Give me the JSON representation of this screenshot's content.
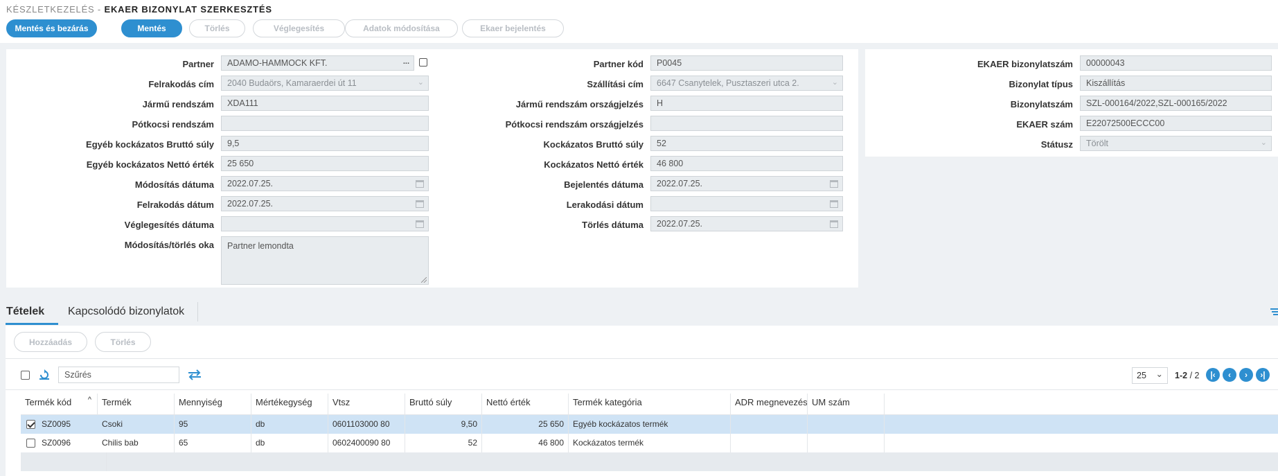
{
  "breadcrumb": {
    "parent": "KÉSZLETKEZELÉS -",
    "current": "EKAER BIZONYLAT SZERKESZTÉS"
  },
  "toolbar": {
    "save_close": "Mentés és bezárás",
    "save": "Mentés",
    "delete": "Törlés",
    "finalize": "Véglegesítés",
    "modify_data": "Adatok módosítása",
    "report": "Ekaer bejelentés"
  },
  "form_left": {
    "partner_label": "Partner",
    "partner_value": "ADAMO-HAMMOCK KFT.",
    "loading_addr_label": "Felrakodás cím",
    "loading_addr_value": "2040 Budaörs, Kamaraerdei út 11",
    "vehicle_plate_label": "Jármű rendszám",
    "vehicle_plate_value": "XDA111",
    "trailer_plate_label": "Pótkocsi rendszám",
    "trailer_plate_value": "",
    "other_gross_label": "Egyéb kockázatos Bruttó súly",
    "other_gross_value": "9,5",
    "other_net_label": "Egyéb kockázatos Nettó érték",
    "other_net_value": "25 650",
    "mod_date_label": "Módosítás dátuma",
    "mod_date_value": "2022.07.25.",
    "load_date_label": "Felrakodás dátum",
    "load_date_value": "2022.07.25.",
    "final_date_label": "Véglegesítés dátuma",
    "final_date_value": "",
    "reason_label": "Módosítás/törlés oka",
    "reason_value": "Partner lemondta"
  },
  "form_mid": {
    "partner_code_label": "Partner kód",
    "partner_code_value": "P0045",
    "delivery_addr_label": "Szállítási cím",
    "delivery_addr_value": "6647 Csanytelek, Pusztaszeri utca 2.",
    "vehicle_country_label": "Jármű rendszám országjelzés",
    "vehicle_country_value": "H",
    "trailer_country_label": "Pótkocsi rendszám országjelzés",
    "trailer_country_value": "",
    "risky_gross_label": "Kockázatos Bruttó súly",
    "risky_gross_value": "52",
    "risky_net_label": "Kockázatos Nettó érték",
    "risky_net_value": "46 800",
    "report_date_label": "Bejelentés dátuma",
    "report_date_value": "2022.07.25.",
    "unload_date_label": "Lerakodási dátum",
    "unload_date_value": "",
    "delete_date_label": "Törlés dátuma",
    "delete_date_value": "2022.07.25."
  },
  "form_right": {
    "doc_no_label": "EKAER bizonylatszám",
    "doc_no_value": "00000043",
    "doc_type_label": "Bizonylat típus",
    "doc_type_value": "Kiszállítás",
    "doc_nums_label": "Bizonylatszám",
    "doc_nums_value": "SZL-000164/2022,SZL-000165/2022",
    "ekaer_no_label": "EKAER szám",
    "ekaer_no_value": "E22072500ECCC00",
    "status_label": "Státusz",
    "status_value": "Törölt"
  },
  "tabs": {
    "items": "Tételek",
    "related": "Kapcsolódó bizonylatok"
  },
  "grid_toolbar": {
    "add": "Hozzáadás",
    "delete": "Törlés",
    "filter_placeholder": "Szűrés",
    "page_size": "25",
    "range": "1-2",
    "total": "/ 2"
  },
  "columns": [
    "Termék kód",
    "Termék",
    "Mennyiség",
    "Mértékegység",
    "Vtsz",
    "Bruttó súly",
    "Nettó érték",
    "Termék kategória",
    "ADR megnevezés",
    "UM szám"
  ],
  "rows": [
    {
      "code": "SZ0095",
      "product": "Csoki",
      "qty": "95",
      "unit": "db",
      "vtsz": "0601103000 80",
      "gross": "9,50",
      "net": "25 650",
      "category": "Egyéb kockázatos termék",
      "adr": "",
      "um": "",
      "checked": true
    },
    {
      "code": "SZ0096",
      "product": "Chilis bab",
      "qty": "65",
      "unit": "db",
      "vtsz": "0602400090 80",
      "gross": "52",
      "net": "46 800",
      "category": "Kockázatos termék",
      "adr": "",
      "um": "",
      "checked": false
    }
  ],
  "colors": {
    "accent": "#2e8fd0",
    "selected_row": "#cfe3f5",
    "field_bg": "#e8ecef"
  },
  "icons": [
    "edit-icon",
    "ellipsis-icon",
    "calendar-icon",
    "chevron-down-icon",
    "refresh-icon",
    "swap-icon",
    "filter-settings-icon",
    "first-page-icon",
    "prev-page-icon",
    "next-page-icon",
    "last-page-icon"
  ]
}
